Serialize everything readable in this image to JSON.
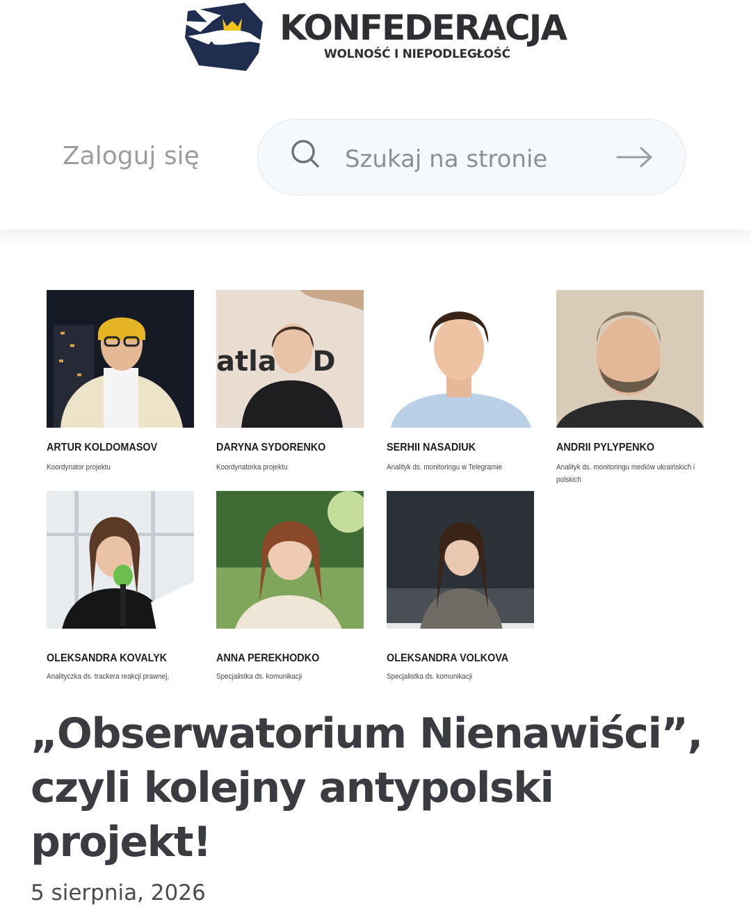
{
  "header": {
    "logo_title": "KONFEDERACJA",
    "logo_subtitle": "WOLNOŚĆ I NIEPODLEGŁOŚĆ",
    "login_label": "Zaloguj się",
    "search_placeholder": "Szukaj na stronie",
    "icons": [
      "eagle-logo-icon",
      "search-icon",
      "arrow-right-icon"
    ],
    "colors": {
      "brand_navy": "#1f2d4f",
      "crown_gold": "#f3c21b"
    }
  },
  "team": [
    {
      "name": "ARTUR KOLDOMASOV",
      "role": "Koordynator projektu"
    },
    {
      "name": "DARYNA SYDORENKO",
      "role": "Koordynatorka projektu"
    },
    {
      "name": "SERHII NASADIUK",
      "role": "Analityk ds. monitoringu w Telegramie"
    },
    {
      "name": "ANDRII PYLYPENKO",
      "role": "Analityk ds. monitoringu mediów ukraińskich i polskich"
    },
    {
      "name": "OLEKSANDRA KOVALYK",
      "role": "Analityczka ds. trackera reakcji prawnej,"
    },
    {
      "name": "ANNA PEREKHODKO",
      "role": "Specjalistka ds. komunikacji"
    },
    {
      "name": "OLEKSANDRA VOLKOVA",
      "role": "Specjalistka ds. komunikacji"
    }
  ],
  "photo_text": "atla  c  D",
  "article": {
    "title": "„Obserwatorium Nienawiści”, czyli kolejny antypolski projekt!",
    "date": "5 sierpnia, 2026"
  }
}
